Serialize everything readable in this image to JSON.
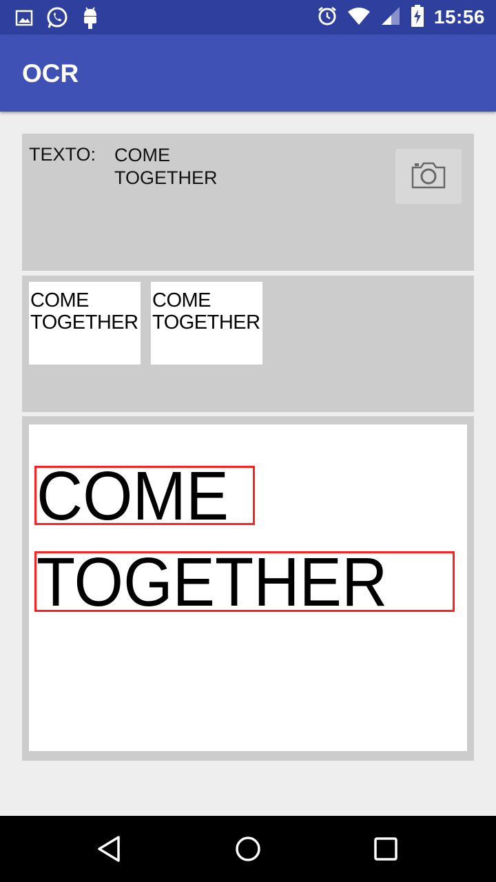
{
  "status_bar": {
    "time": "15:56",
    "icons": [
      "image-icon",
      "whatsapp-icon",
      "android-icon",
      "alarm-icon",
      "wifi-icon",
      "signal-icon",
      "battery-charging-icon"
    ]
  },
  "app_bar": {
    "title": "OCR"
  },
  "text_panel": {
    "label": "TEXTO:",
    "line1": "COME",
    "line2": "TOGETHER",
    "camera_button_icon": "camera-icon"
  },
  "thumbnails": [
    {
      "line1": "COME",
      "line2": "TOGETHER"
    },
    {
      "line1": "COME",
      "line2": "TOGETHER"
    }
  ],
  "image_preview": {
    "words": [
      "COME",
      "TOGETHER"
    ],
    "box_color": "#ff2020"
  },
  "nav_bar": {
    "buttons": [
      "back-icon",
      "home-icon",
      "recents-icon"
    ]
  },
  "colors": {
    "primary": "#3f51b5",
    "primary_dark": "#2f3f9e",
    "panel_bg": "#cccccc",
    "page_bg": "#eeeeee"
  }
}
